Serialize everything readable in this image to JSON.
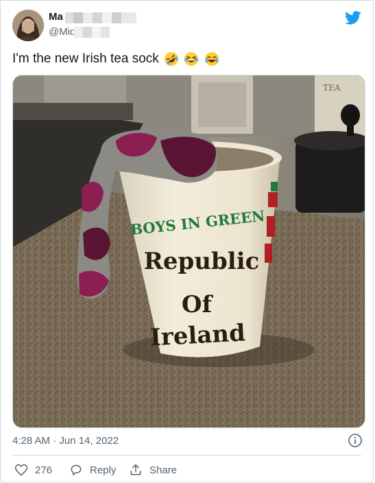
{
  "user": {
    "display_name": "Ma",
    "handle": "@Mid"
  },
  "tweet": {
    "text": "I'm the new Irish tea sock",
    "emojis": [
      "rolling-on-floor-laughing",
      "grinning-squinting-tears",
      "face-with-tears-of-joy"
    ]
  },
  "photo": {
    "mug_arc_text": "BOYS IN GREEN",
    "mug_line1": "Republic",
    "mug_line2": "Of",
    "mug_line3": "Ireland",
    "pot_label": "TEA"
  },
  "meta": {
    "timestamp": "4:28 AM · Jun 14, 2022"
  },
  "actions": {
    "like_count": "276",
    "reply_label": "Reply",
    "share_label": "Share"
  },
  "colors": {
    "brand": "#1d9bf0",
    "text": "#0f1419",
    "secondary": "#536471",
    "border": "#cfd9de",
    "mug_green": "#1f7a3a"
  }
}
